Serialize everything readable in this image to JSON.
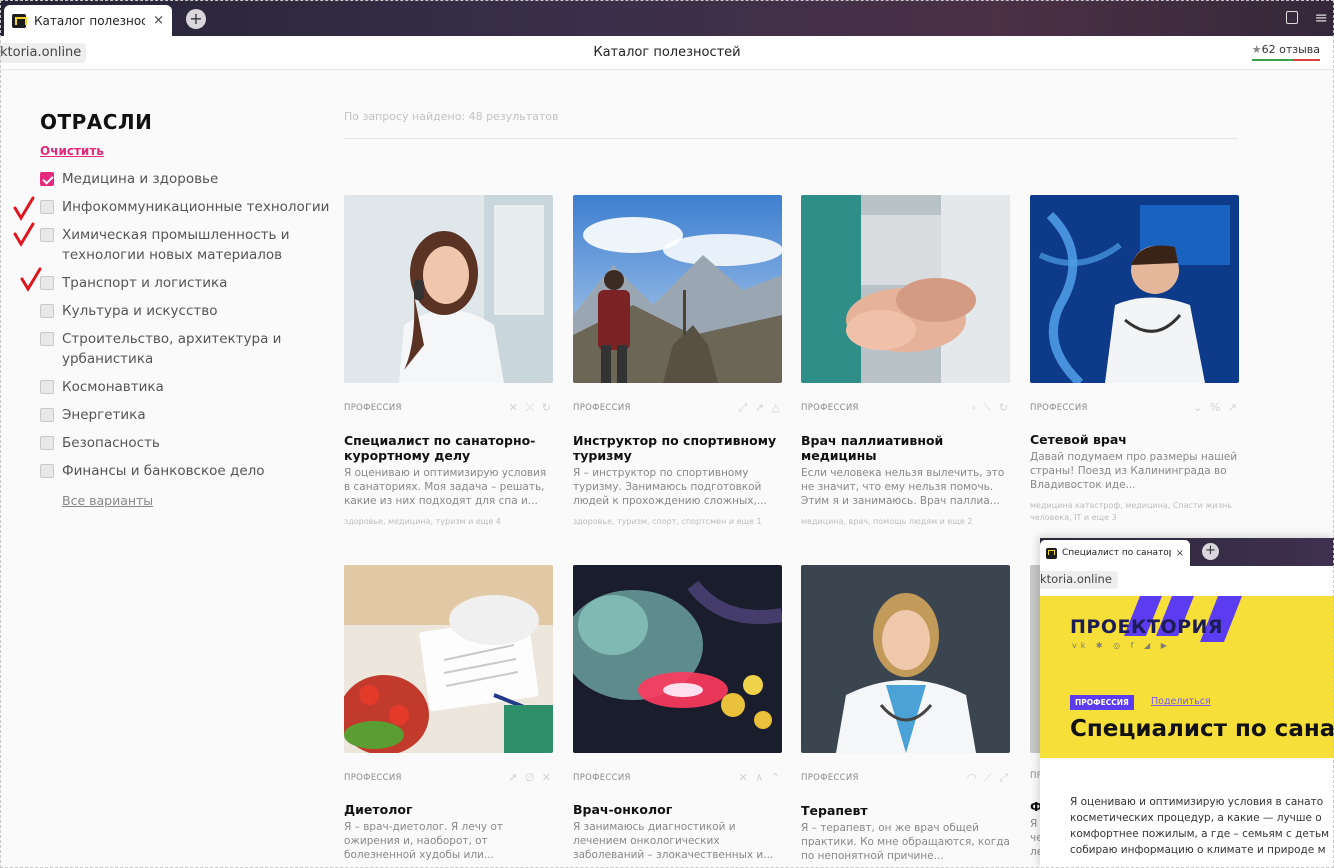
{
  "browser": {
    "tab_title": "Каталог полезностей",
    "tab_close": "×",
    "new_tab": "+",
    "url": "ktoria.online",
    "page_title": "Каталог полезностей",
    "reviews": "62 отзыва"
  },
  "filters": {
    "heading": "ОТРАСЛИ",
    "clear": "Очистить",
    "options": [
      {
        "label": "Медицина и здоровье",
        "checked": true
      },
      {
        "label": "Инфокоммуникационные технологии",
        "checked": false
      },
      {
        "label": "Химическая промышленность и технологии новых материалов",
        "checked": false
      },
      {
        "label": "Транспорт и логистика",
        "checked": false
      },
      {
        "label": "Культура и искусство",
        "checked": false
      },
      {
        "label": "Строительство, архитектура и урбанистика",
        "checked": false
      },
      {
        "label": "Космонавтика",
        "checked": false
      },
      {
        "label": "Энергетика",
        "checked": false
      },
      {
        "label": "Безопасность",
        "checked": false
      },
      {
        "label": "Финансы и банковское дело",
        "checked": false
      }
    ],
    "all_options": "Все варианты"
  },
  "results": {
    "found": "По запросу найдено: 48 результатов",
    "cards": [
      {
        "badge": "ПРОФЕССИЯ",
        "title": "Специалист по санаторно-курортному делу",
        "desc": "Я оцениваю и оптимизирую условия в санаториях. Моя задача – решать, какие из них подходят для спа и...",
        "tags": "здоровье, медицина, туризм и еще 4",
        "icons": "✕ ⤫ ↻"
      },
      {
        "badge": "ПРОФЕССИЯ",
        "title": "Инструктор по спортивному туризму",
        "desc": "Я – инструктор по спортивному туризму. Занимаюсь подготовкой людей к прохождению сложных,...",
        "tags": "здоровье, туризм, спорт, спортсмен и еще 1",
        "icons": "⤢ ↗ △"
      },
      {
        "badge": "ПРОФЕССИЯ",
        "title": "Врач паллиативной медицины",
        "desc": "Если человека нельзя вылечить, это не значит, что ему нельзя помочь. Этим я и занимаюсь. Врач паллиа...",
        "tags": "медицина, врач, помощь людям и еще 2",
        "icons": "› ⟍ ↻"
      },
      {
        "badge": "ПРОФЕССИЯ",
        "title": "Сетевой врач",
        "desc": "Давай подумаем про размеры нашей страны! Поезд из Калининграда во Владивосток иде...",
        "tags": "медицина катастроф, медицина, Спасти жизнь человека, IT и еще 3",
        "icons": "⌄ % ↗"
      },
      {
        "badge": "ПРОФЕССИЯ",
        "title": "Диетолог",
        "desc": "Я – врач-диетолог. Я лечу от ожирения и, наоборот, от болезненной худобы или...",
        "tags": "",
        "icons": "↗ ∅ ✕"
      },
      {
        "badge": "ПРОФЕССИЯ",
        "title": "Врач-онколог",
        "desc": "Я занимаюсь диагностикой и лечением онкологических заболеваний – злокачественных и...",
        "tags": "",
        "icons": "✕ ∧ ⌃"
      },
      {
        "badge": "ПРОФЕССИЯ",
        "title": "Терапевт",
        "desc": "Я – терапевт, он же врач общей практики. Ко мне обращаются, когда по непонятной причине...",
        "tags": "",
        "icons": "◠ ⟋ ⤢"
      }
    ]
  },
  "overlay": {
    "tab_title": "Специалист по санатор",
    "tab_close": "×",
    "new_tab": "+",
    "url": "ktoria.online",
    "logo": "ПРОЕКТОРИЯ",
    "socials": "vk ✱ ◎ f ◢ ▶",
    "badge": "ПРОФЕССИЯ",
    "share": "Поделиться",
    "title": "Специалист по сана",
    "lines": [
      "Я оцениваю и оптимизирую условия в санато",
      "косметических процедур, а какие — лучше о",
      "комфортнее пожилым, а где – семьям с детьм",
      "собираю информацию о климате и природе м"
    ]
  },
  "behind": {
    "card8_badge": "ПР",
    "card8_title": "Ф",
    "card8_desc": "Я\nче\nле"
  },
  "colors": {
    "accent": "#e4287c",
    "brand_yellow": "#f7df3a",
    "brand_violet": "#5b3cf0",
    "annotation_red": "#e0141e"
  }
}
